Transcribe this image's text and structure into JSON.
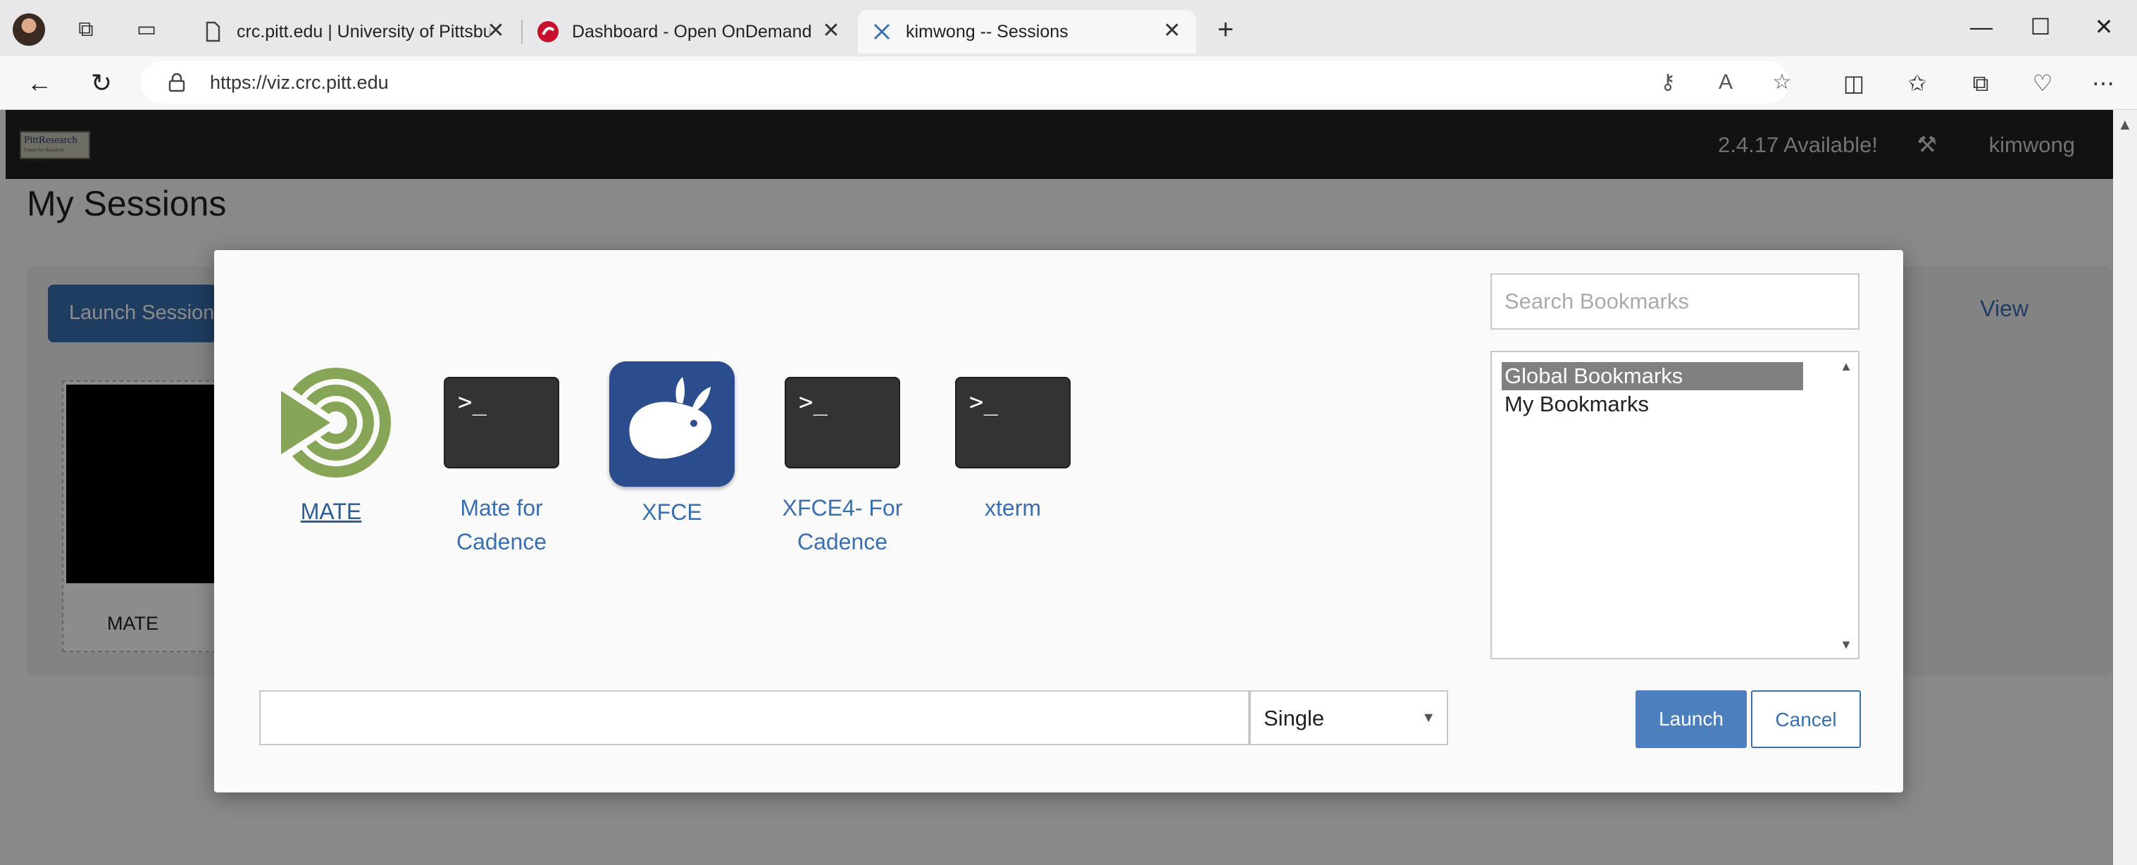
{
  "browser": {
    "tabs": [
      {
        "title": "crc.pitt.edu | University of Pittsbur"
      },
      {
        "title": "Dashboard - Open OnDemand"
      },
      {
        "title": "kimwong -- Sessions"
      }
    ],
    "url": "https://viz.crc.pitt.edu",
    "window_controls": {
      "minimize": "—",
      "maximize": "☐",
      "close": "✕"
    }
  },
  "page": {
    "logo_text": "PittResearch",
    "logo_subtext": "Center for Research Computing",
    "update_notice": "2.4.17 Available!",
    "user": "kimwong",
    "title": "My Sessions",
    "launch_session_label": "Launch Session",
    "view_label": "View",
    "session_card_name": "MATE"
  },
  "modal": {
    "apps": [
      {
        "line1": "MATE",
        "line2": ""
      },
      {
        "line1": "Mate for",
        "line2": "Cadence"
      },
      {
        "line1": "XFCE",
        "line2": ""
      },
      {
        "line1": "XFCE4- For",
        "line2": "Cadence"
      },
      {
        "line1": "xterm",
        "line2": ""
      }
    ],
    "terminal_prompt": ">_",
    "search_placeholder": "Search Bookmarks",
    "bookmarks": [
      "Global Bookmarks",
      "My Bookmarks"
    ],
    "name_input_value": "",
    "mode_selected": "Single",
    "launch_label": "Launch",
    "cancel_label": "Cancel"
  },
  "colors": {
    "accent": "#3a6fb0",
    "navbar": "#222222",
    "mate_green": "#87a556",
    "xfce_blue": "#2c4d8d"
  }
}
